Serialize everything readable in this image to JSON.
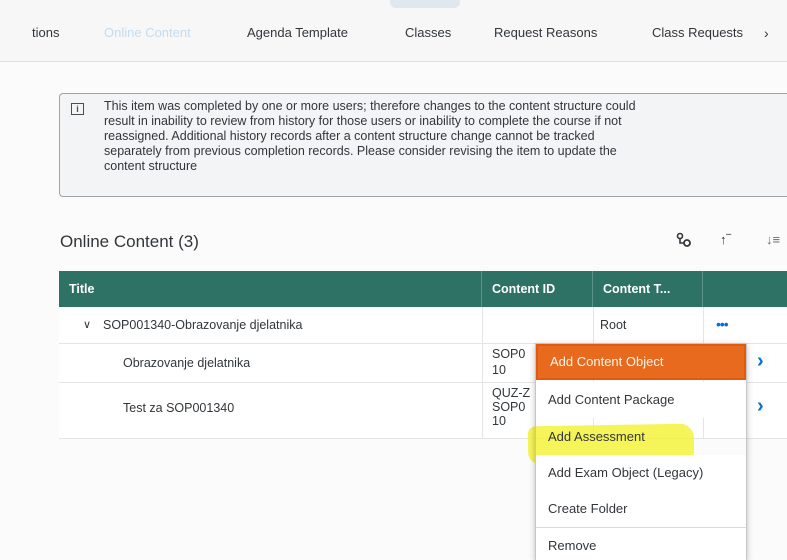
{
  "tabs": [
    {
      "label": "tions",
      "selected": false
    },
    {
      "label": "Online Content",
      "selected": true
    },
    {
      "label": "Agenda Template",
      "selected": false
    },
    {
      "label": "Classes",
      "selected": false
    },
    {
      "label": "Request Reasons",
      "selected": false
    },
    {
      "label": "Class Requests",
      "selected": false
    }
  ],
  "tab_overflow_icon": "chevron-right-icon",
  "info": {
    "icon": "info-icon",
    "lines": [
      "This item was completed by one or more users; therefore changes to the content structure could",
      "result in inability to review from history for those users or inability to complete the course if not",
      "reassigned. Additional history records after a content structure change cannot be tracked",
      "separately from previous completion records. Please consider revising the item to update the",
      "content structure"
    ]
  },
  "section": {
    "title": "Online Content (3)",
    "toolbar_icons": [
      "hierarchy-icon",
      "sort-ascending-icon",
      "sort-descending-icon"
    ]
  },
  "table": {
    "headers": [
      "Title",
      "Content ID",
      "Content T..."
    ],
    "rows": [
      {
        "title": "SOP001340-Obrazovanje djelatnika",
        "content_id": [],
        "content_type": "Root",
        "action": "more-icon"
      },
      {
        "title": "Obrazovanje djelatnika",
        "content_id": [
          "SOP0",
          "10"
        ],
        "content_type": "",
        "action": "chevron-right-icon"
      },
      {
        "title": "Test za SOP001340",
        "content_id": [
          "QUZ-Z",
          "SOP0",
          "10"
        ],
        "content_type": "",
        "action": "chevron-right-icon"
      }
    ]
  },
  "context_menu": {
    "items": [
      {
        "label": "Add Content Object",
        "active": true
      },
      {
        "label": "Add Content Package",
        "active": false
      },
      {
        "label": "Add Assessment",
        "active": false,
        "highlighted": true
      },
      {
        "label": "Add Exam Object (Legacy)",
        "active": false
      },
      {
        "label": "Create Folder",
        "active": false
      },
      {
        "label": "Remove",
        "active": false
      }
    ]
  },
  "colors": {
    "table_header": "#2e7265",
    "menu_active": "#e86a1e",
    "highlight": "#f3f23c",
    "link_blue": "#0a6ed1"
  }
}
